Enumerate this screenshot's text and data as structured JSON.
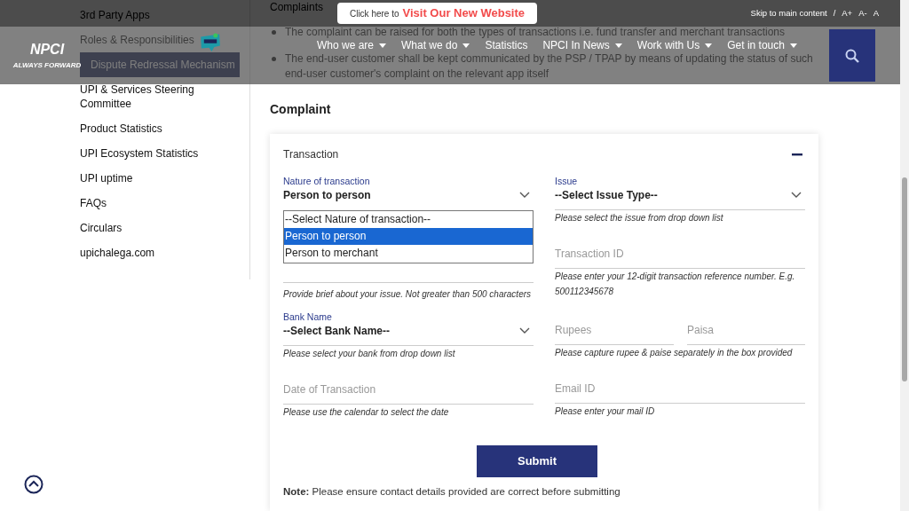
{
  "top_bar": {
    "link_prefix": "Click here to",
    "link_text": "Visit Our New Website",
    "skip_link": "Skip to main content",
    "separator": "/",
    "font_controls": [
      "A+",
      "A-",
      "A"
    ]
  },
  "header": {
    "logo_text": "NPCI",
    "logo_tagline": "ALWAYS FORWARD",
    "nav": [
      {
        "label": "Who we are",
        "has_menu": true
      },
      {
        "label": "What we do",
        "has_menu": true
      },
      {
        "label": "Statistics",
        "has_menu": false
      },
      {
        "label": "NPCI In News",
        "has_menu": true
      },
      {
        "label": "Work with Us",
        "has_menu": true
      },
      {
        "label": "Get in touch",
        "has_menu": true
      }
    ]
  },
  "sidebar": {
    "items": [
      {
        "label": "3rd Party Apps",
        "selected": false
      },
      {
        "label": "Roles & Responsibilities",
        "selected": false
      },
      {
        "label": "Dispute Redressal Mechanism",
        "selected": true
      },
      {
        "label": "UPI & Services Steering Committee",
        "selected": false
      },
      {
        "label": "Product Statistics",
        "selected": false
      },
      {
        "label": "UPI Ecosystem Statistics",
        "selected": false
      },
      {
        "label": "UPI uptime",
        "selected": false
      },
      {
        "label": "FAQs",
        "selected": false
      },
      {
        "label": "Circulars",
        "selected": false
      },
      {
        "label": "upichalega.com",
        "selected": false
      }
    ]
  },
  "content": {
    "intro": "Complaints",
    "bullets": [
      "The complaint can be raised for both the types of transactions i.e. fund transfer and merchant transactions",
      "The end-user customer shall be kept communicated by the PSP / TPAP by means of updating the status of such end-user customer's complaint on the relevant app itself"
    ],
    "heading": "Complaint"
  },
  "form": {
    "section_title": "Transaction",
    "expanded": true,
    "nature": {
      "label": "Nature of transaction",
      "value": "Person to person",
      "open": true,
      "options": [
        {
          "label": "--Select Nature of transaction--",
          "selected": false
        },
        {
          "label": "Person to person",
          "selected": true
        },
        {
          "label": "Person to merchant",
          "selected": false
        }
      ]
    },
    "issue": {
      "label": "Issue",
      "value": "--Select Issue Type--",
      "hint": "Please select the issue from drop down list"
    },
    "description": {
      "hint": "Provide brief about your issue. Not greater than 500 characters"
    },
    "transaction_id": {
      "placeholder": "Transaction ID",
      "hint": "Please enter your 12-digit transaction reference number. E.g. 500112345678"
    },
    "bank": {
      "label": "Bank Name",
      "value": "--Select Bank Name--",
      "hint": "Please select your bank from drop down list"
    },
    "amount": {
      "rupees_placeholder": "Rupees",
      "paisa_placeholder": "Paisa",
      "hint": "Please capture rupee & paise separately in the box provided"
    },
    "date": {
      "placeholder": "Date of Transaction",
      "hint": "Please use the calendar to select the date"
    },
    "email": {
      "placeholder": "Email ID",
      "hint": "Please enter your mail ID"
    },
    "submit": "Submit",
    "note": "**Note:** Please ensure contact details provided are correct before submitting"
  }
}
